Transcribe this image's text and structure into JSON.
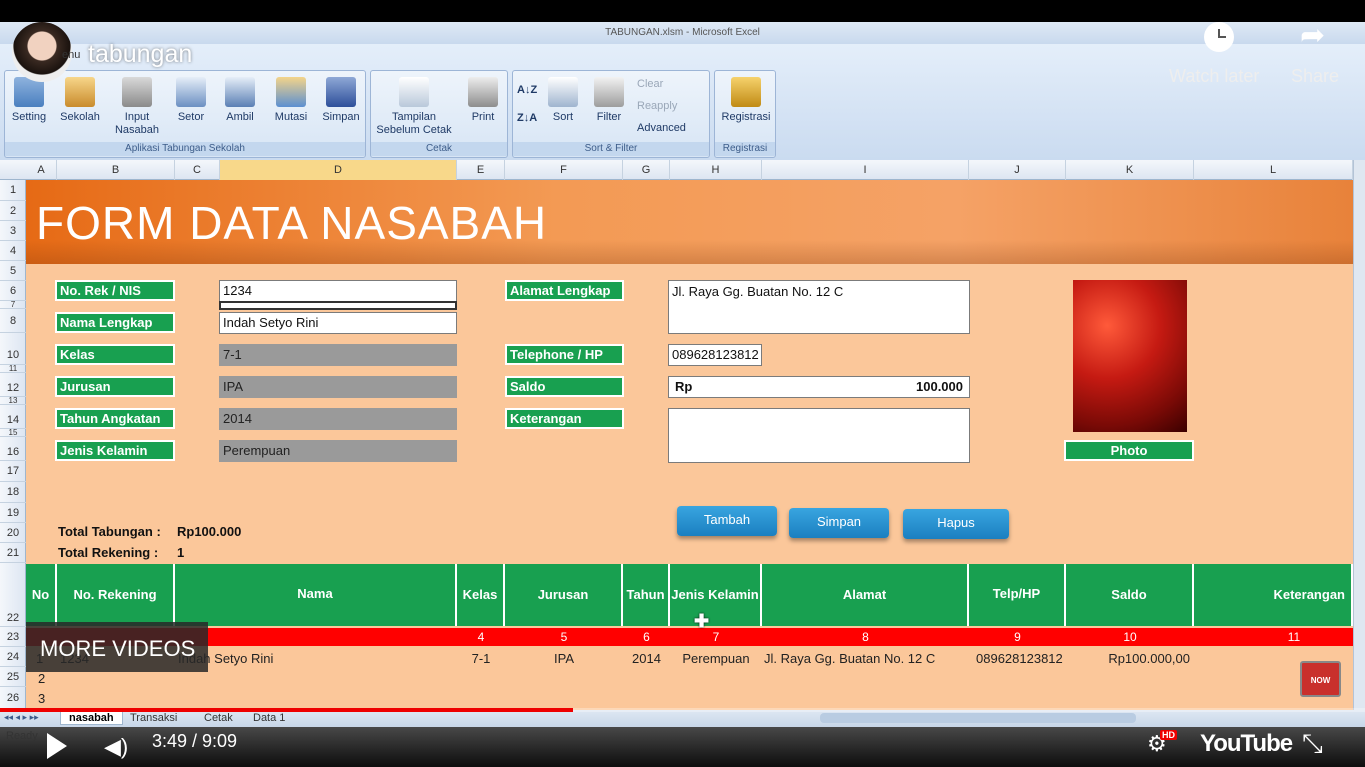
{
  "video": {
    "title": "tabungan",
    "watch_later": "Watch later",
    "share": "Share",
    "more_videos": "MORE VIDEOS",
    "time": "3:49 / 9:09",
    "progress": 0.42,
    "logo": "YouTube",
    "hd_badge": "HD",
    "subscribe_badge": "NOW"
  },
  "excel": {
    "title": "TABUNGAN.xlsm - Microsoft Excel",
    "menu_stub": "enu",
    "status": "Ready",
    "groups": [
      {
        "label": "Aplikasi Tabungan Sekolah"
      },
      {
        "label": "Cetak"
      },
      {
        "label": "Sort & Filter"
      },
      {
        "label": "Registrasi"
      }
    ],
    "buttons": {
      "setting": "Setting",
      "sekolah": "Sekolah",
      "input_nasabah": "Input Nasabah",
      "setor": "Setor",
      "ambil": "Ambil",
      "mutasi": "Mutasi",
      "simpan": "Simpan",
      "tampilan": "Tampilan Sebelum Cetak",
      "print": "Print",
      "sort": "Sort",
      "filter": "Filter",
      "clear": "Clear",
      "reapply": "Reapply",
      "advanced": "Advanced",
      "registrasi": "Registrasi"
    },
    "columns": [
      "A",
      "B",
      "C",
      "D",
      "E",
      "F",
      "G",
      "H",
      "I",
      "J",
      "K",
      "L"
    ],
    "rows": [
      "1",
      "2",
      "3",
      "4",
      "5",
      "6",
      "7",
      "8",
      "10",
      "11",
      "12",
      "13",
      "14",
      "15",
      "16",
      "17",
      "18",
      "19",
      "20",
      "21",
      "22",
      "23",
      "24",
      "25",
      "26"
    ],
    "sheet_tabs": [
      "nasabah",
      "Transaksi",
      "Cetak",
      "Data 1"
    ]
  },
  "form": {
    "title": "FORM DATA NASABAH",
    "labels": {
      "no_rek": "No. Rek / NIS",
      "nama": "Nama Lengkap",
      "kelas": "Kelas",
      "jurusan": "Jurusan",
      "tahun": "Tahun Angkatan",
      "jk": "Jenis Kelamin",
      "alamat": "Alamat Lengkap",
      "telp": "Telephone / HP",
      "saldo": "Saldo",
      "ket": "Keterangan",
      "photo": "Photo"
    },
    "values": {
      "no_rek": "1234",
      "nama": "Indah Setyo Rini",
      "kelas": "7-1",
      "jurusan": "IPA",
      "tahun": "2014",
      "jk": "Perempuan",
      "alamat": "Jl. Raya Gg. Buatan No. 12 C",
      "telp": "089628123812",
      "saldo_prefix": "Rp",
      "saldo": "100.000",
      "ket": ""
    },
    "totals": {
      "tabungan_label": "Total Tabungan :",
      "tabungan_value": "Rp100.000",
      "rekening_label": "Total Rekening :",
      "rekening_value": "1"
    },
    "actions": {
      "tambah": "Tambah",
      "simpan": "Simpan",
      "hapus": "Hapus"
    }
  },
  "table": {
    "headers": [
      "No",
      "No. Rekening",
      "Nama",
      "Kelas",
      "Jurusan",
      "Tahun",
      "Jenis Kelamin",
      "Alamat",
      "Telp/HP",
      "Saldo",
      "Keterangan"
    ],
    "numbers": [
      "4",
      "5",
      "6",
      "7",
      "8",
      "9",
      "10",
      "11"
    ],
    "row1": {
      "no": "1",
      "rek": "1234",
      "nama": "Indah Setyo Rini",
      "kelas": "7-1",
      "jurusan": "IPA",
      "tahun": "2014",
      "jk": "Perempuan",
      "alamat": "Jl. Raya Gg. Buatan No. 12 C",
      "telp": "089628123812",
      "saldo": "Rp100.000,00"
    },
    "row2_no": "2",
    "row3_no": "3"
  }
}
